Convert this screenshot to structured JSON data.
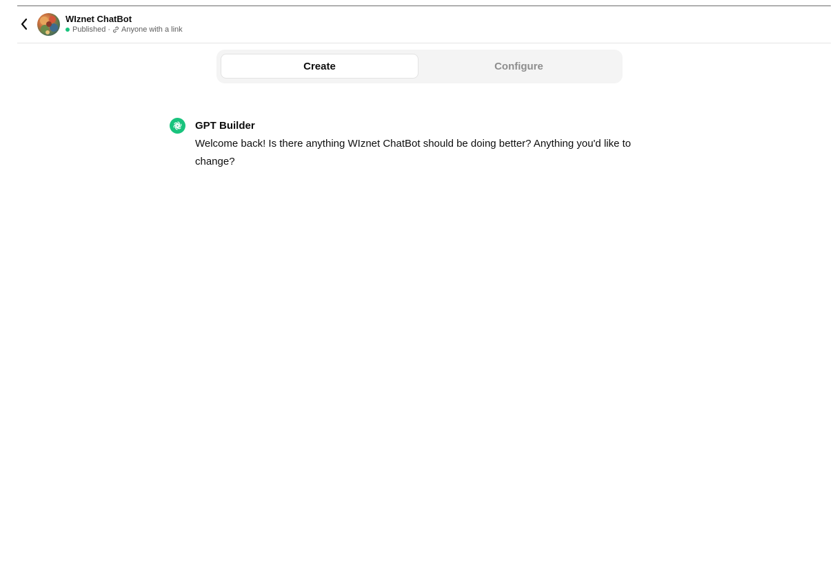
{
  "header": {
    "gpt_name": "WIznet ChatBot",
    "status": "Published",
    "separator": "·",
    "visibility": "Anyone with a link",
    "back_icon": "chevron-left-icon",
    "link_icon": "link-icon"
  },
  "tabs": [
    {
      "label": "Create",
      "active": true
    },
    {
      "label": "Configure",
      "active": false
    }
  ],
  "conversation": {
    "messages": [
      {
        "sender": "GPT Builder",
        "text": "Welcome back! Is there anything WIznet ChatBot should be doing better? Anything you'd like to change?",
        "icon": "openai-logo-icon"
      }
    ]
  },
  "colors": {
    "status_green": "#19c37d",
    "builder_icon_bg": "#19c37d",
    "tab_bar_bg": "#f4f4f4",
    "inactive_tab_text": "#8e8e8e"
  }
}
